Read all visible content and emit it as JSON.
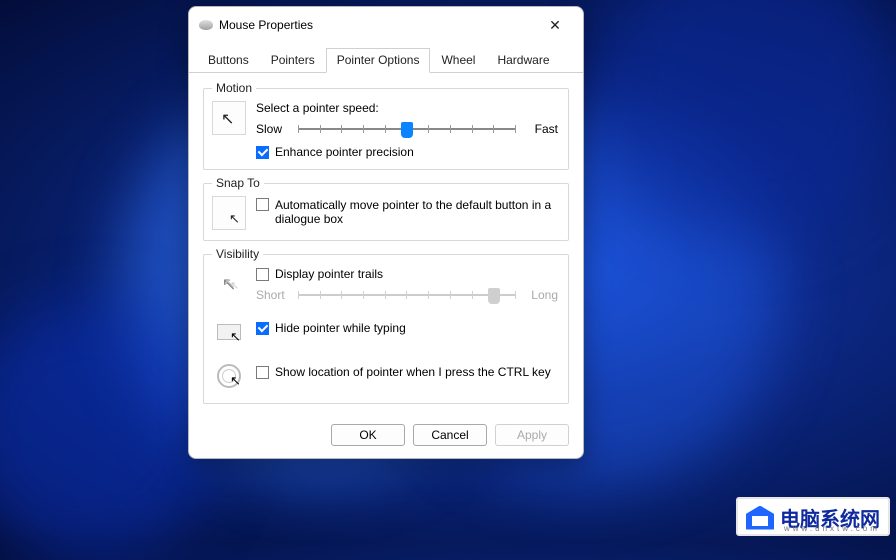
{
  "window": {
    "title": "Mouse Properties"
  },
  "tabs": [
    "Buttons",
    "Pointers",
    "Pointer Options",
    "Wheel",
    "Hardware"
  ],
  "active_tab": 2,
  "motion": {
    "legend": "Motion",
    "select_label": "Select a pointer speed:",
    "slow": "Slow",
    "fast": "Fast",
    "speed_percent": 50,
    "enhance_label": "Enhance pointer precision",
    "enhance_checked": true
  },
  "snapto": {
    "legend": "Snap To",
    "auto_label": "Automatically move pointer to the default button in a dialogue box",
    "auto_checked": false
  },
  "visibility": {
    "legend": "Visibility",
    "trails_label": "Display pointer trails",
    "trails_checked": false,
    "trails_short": "Short",
    "trails_long": "Long",
    "trails_percent": 90,
    "hide_label": "Hide pointer while typing",
    "hide_checked": true,
    "ctrl_label": "Show location of pointer when I press the CTRL key",
    "ctrl_checked": false
  },
  "buttons": {
    "ok": "OK",
    "cancel": "Cancel",
    "apply": "Apply"
  },
  "watermark": {
    "text": "电脑系统网",
    "url": "www.dnxtw.com"
  }
}
